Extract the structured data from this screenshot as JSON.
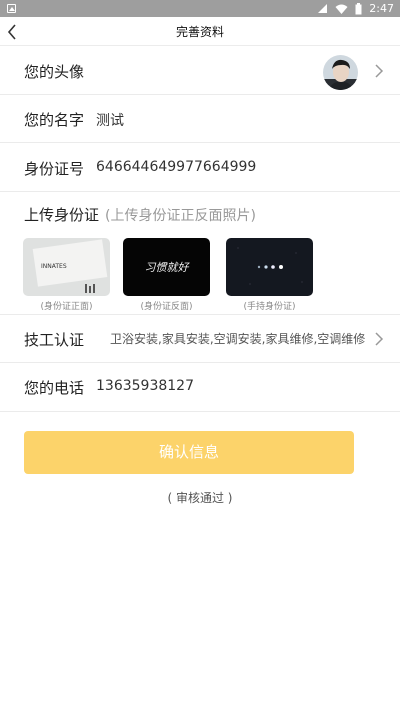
{
  "status_bar": {
    "time": "2:47"
  },
  "nav": {
    "title": "完善资料"
  },
  "avatar_row": {
    "label": "您的头像"
  },
  "name_row": {
    "label": "您的名字",
    "value": "测试"
  },
  "id_row": {
    "label": "身份证号",
    "value": "646644649977664999"
  },
  "upload": {
    "title": "上传身份证",
    "hint": "(上传身份证正反面照片)",
    "photos": [
      {
        "caption": "(身份证正面)"
      },
      {
        "caption": "(身份证反面)"
      },
      {
        "caption": "(手持身份证)"
      }
    ],
    "photo_text_front": "INNATES",
    "photo_text_back": "习惯就好"
  },
  "skill_row": {
    "label": "技工认证",
    "value": "卫浴安装,家具安装,空调安装,家具维修,空调维修"
  },
  "phone_row": {
    "label": "您的电话",
    "value": "13635938127"
  },
  "confirm_button": {
    "label": "确认信息"
  },
  "review_status": "( 审核通过 )",
  "colors": {
    "accent": "#fcd36a",
    "status_bar": "#9e9e9e"
  }
}
